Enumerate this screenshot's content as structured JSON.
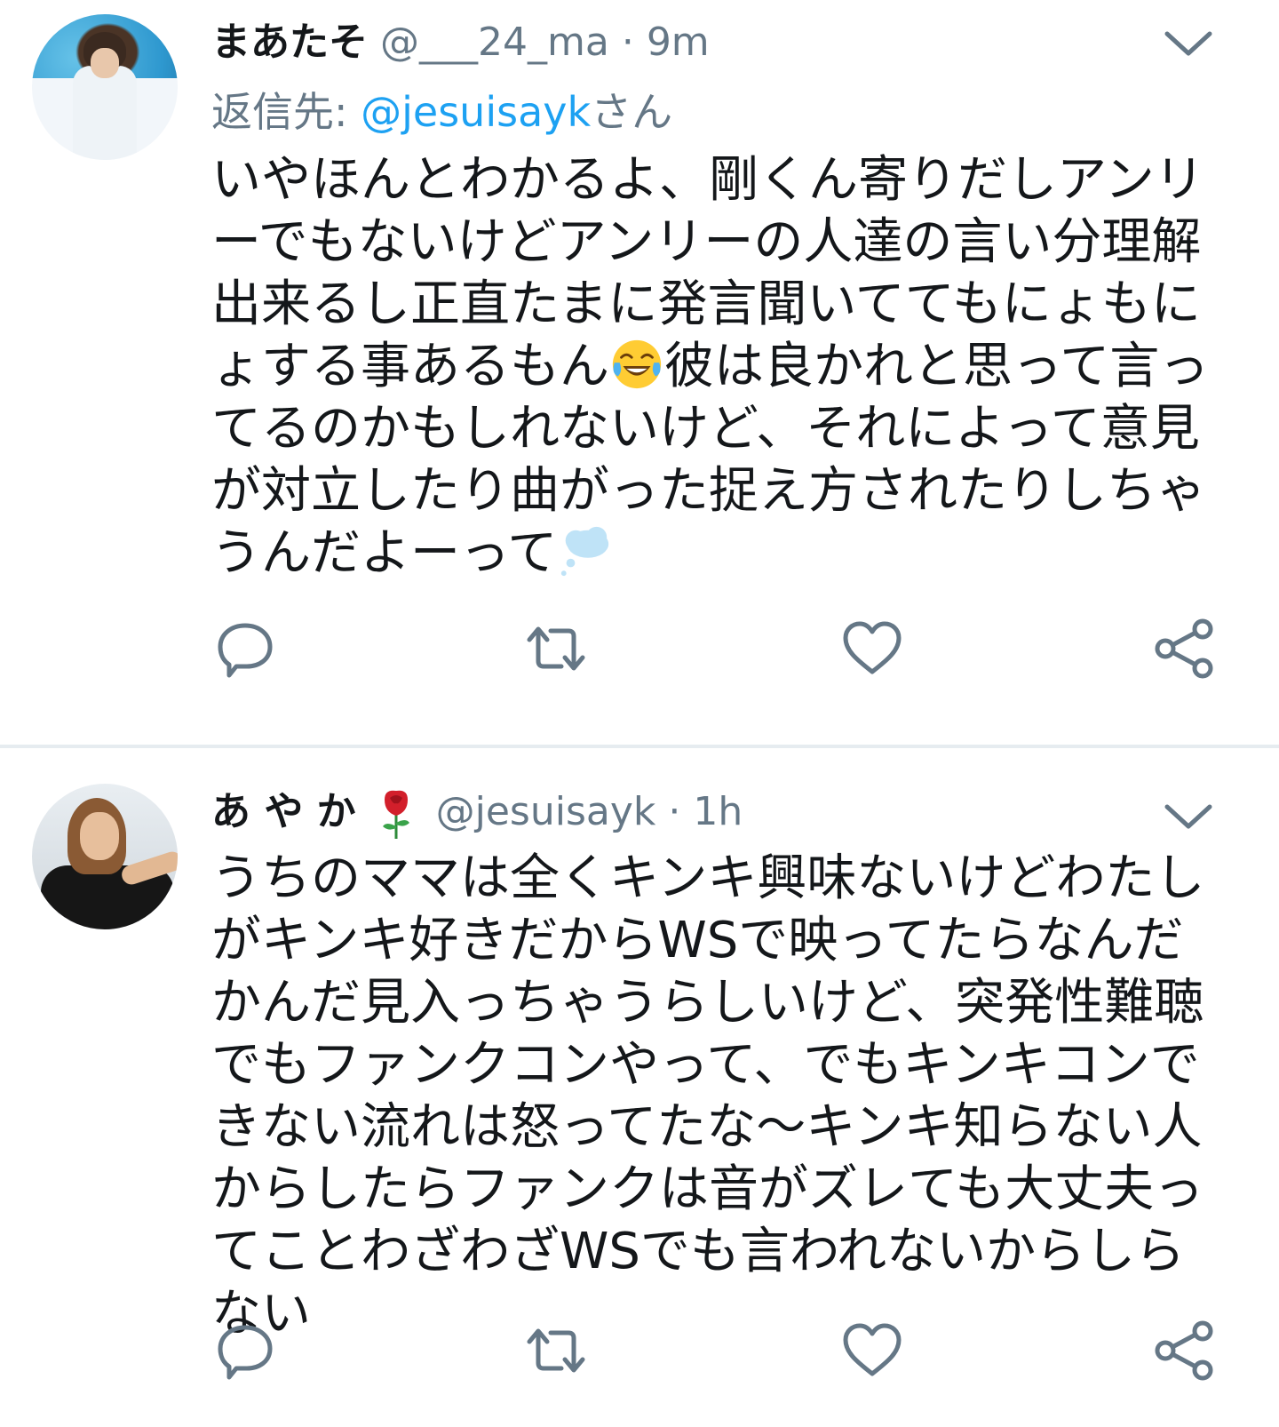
{
  "tweets": [
    {
      "author_name": "まあたそ",
      "handle": "@___24_ma",
      "separator": "·",
      "time": "9m",
      "reply_label": "返信先: ",
      "reply_user": "@jesuisayk",
      "reply_suffix": "さん",
      "text_part1": "いやほんとわかるよ、剛くん寄りだしアンリーでもないけどアンリーの人達の言い分理解出来るし正直たまに発言聞いててもにょもにょする事あるもん",
      "text_part2": "彼は良かれと思って言ってるのかもしれないけど、それによって意見が対立したり曲がった捉え方されたりしちゃうんだよーって",
      "emojis": [
        "face-with-tears-of-joy-emoji",
        "thought-balloon-emoji"
      ]
    },
    {
      "author_name": "あ や か",
      "handle": "@jesuisayk",
      "separator": "·",
      "time": "1h",
      "text": "うちのママは全くキンキ興味ないけどわたしがキンキ好きだからWSで映ってたらなんだかんだ見入っちゃうらしいけど、突発性難聴でもファンクコンやって、でもキンキコンできない流れは怒ってたな〜キンキ知らない人からしたらファンクは音がズレても大丈夫ってことわざわざWSでも言われないからしらない",
      "emojis": [
        "rose-emoji"
      ]
    }
  ],
  "actions": [
    "reply-icon",
    "retweet-icon",
    "like-icon",
    "share-icon"
  ],
  "colors": {
    "text": "#14171a",
    "secondary": "#657786",
    "link": "#1da1f2",
    "icon": "#657786",
    "divider": "#e6ecf0"
  }
}
